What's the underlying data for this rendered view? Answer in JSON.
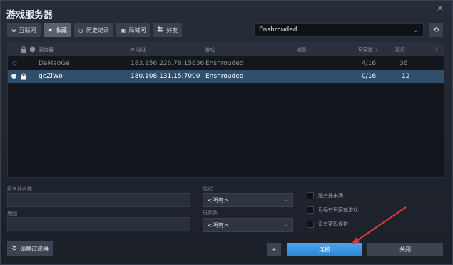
{
  "window": {
    "title": "游戏服务器",
    "close_label": "×"
  },
  "tabs": [
    {
      "label": "互联网",
      "icon": "globe-icon",
      "glyph": "⊕"
    },
    {
      "label": "收藏",
      "icon": "star-icon",
      "glyph": "★"
    },
    {
      "label": "历史记录",
      "icon": "clock-icon",
      "glyph": "◷"
    },
    {
      "label": "局域网",
      "icon": "lan-icon",
      "glyph": "▣"
    },
    {
      "label": "好友",
      "icon": "friends-icon",
      "glyph": "👥"
    }
  ],
  "game_filter": {
    "value": "Enshrouded",
    "chevron": "⌄",
    "refresh_glyph": "⟲"
  },
  "table": {
    "columns": [
      "服务器",
      "IP 地址",
      "游戏",
      "地图",
      "玩家数 ↓",
      "延迟",
      "+"
    ],
    "rows": [
      {
        "name": "DaMaoGe",
        "ip": "183.156.226.78:15636",
        "game": "Enshrouded",
        "map": "",
        "players": "4/16",
        "latency": "36"
      },
      {
        "name": "geZiWo",
        "ip": "180.108.131.15:7000",
        "game": "Enshrouded",
        "map": "",
        "players": "0/16",
        "latency": "12"
      }
    ]
  },
  "filters": {
    "server_name_label": "服务器名称",
    "map_label": "地图",
    "latency_label": "延迟",
    "latency_value": "<所有>",
    "players_label": "玩家数",
    "players_value": "<所有>",
    "check_not_full": "服务器未满",
    "check_has_players": "已经有玩家在游戏",
    "check_no_password": "没有密码保护"
  },
  "buttons": {
    "advanced": "调整过滤器",
    "add": "+",
    "connect": "连接",
    "close": "关闭"
  },
  "colors": {
    "accent": "#2c85d6",
    "selected_row": "#2f4f6f",
    "arrow": "#e0383d"
  }
}
